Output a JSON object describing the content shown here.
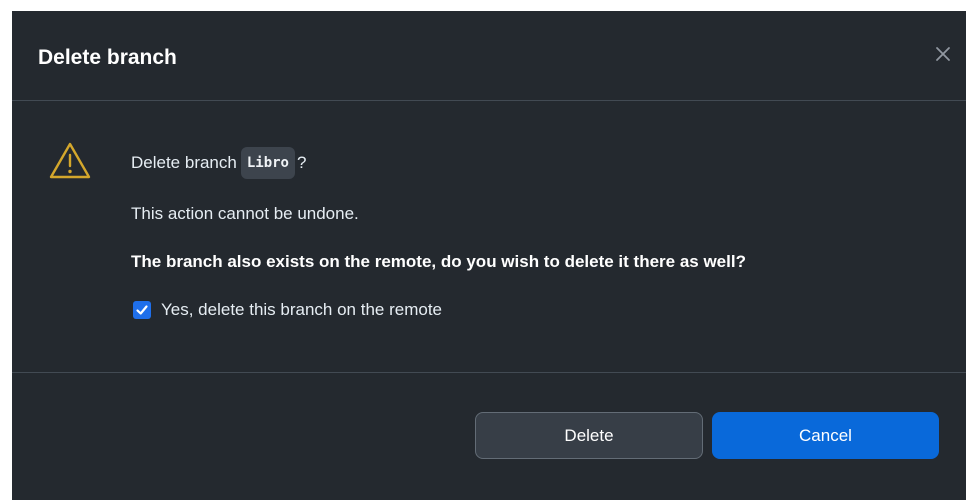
{
  "dialog": {
    "title": "Delete branch",
    "close_icon": "close-icon"
  },
  "body": {
    "warning_icon": "warning-icon",
    "prompt_prefix": "Delete branch",
    "branch_name": "Libro",
    "prompt_suffix": "?",
    "undone_text": "This action cannot be undone.",
    "remote_question": "The branch also exists on the remote, do you wish to delete it there as well?",
    "checkbox": {
      "label": "Yes, delete this branch on the remote",
      "checked": true
    }
  },
  "footer": {
    "delete_label": "Delete",
    "cancel_label": "Cancel"
  },
  "colors": {
    "dialog_bg": "#24292f",
    "warning": "#d4a72c",
    "primary": "#0969da",
    "checkbox": "#1f6feb"
  }
}
